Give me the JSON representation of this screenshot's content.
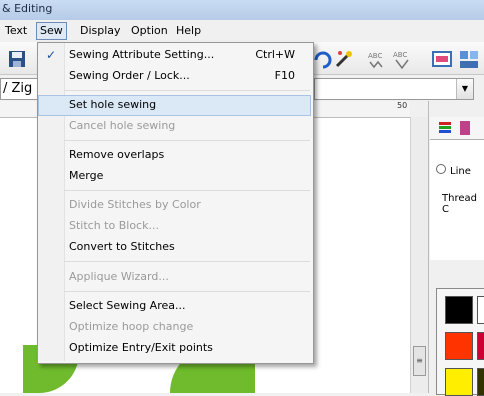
{
  "window": {
    "title": "& Editing"
  },
  "menubar": [
    {
      "label": "Text",
      "active": false
    },
    {
      "label": "Sew",
      "active": true
    },
    {
      "label": "Display",
      "active": false
    },
    {
      "label": "Option",
      "active": false
    },
    {
      "label": "Help",
      "active": false
    }
  ],
  "toolbar": {
    "font_field_value": "/ Zig",
    "combo_arrow": "▼",
    "ruler_mark": "50"
  },
  "sew_menu": {
    "items": [
      {
        "label": "Sewing Attribute Setting...",
        "shortcut": "Ctrl+W",
        "checked": true,
        "enabled": true
      },
      {
        "label": "Sewing Order / Lock...",
        "shortcut": "F10",
        "enabled": true
      },
      {
        "label": "Set hole sewing",
        "shortcut": "",
        "enabled": true,
        "highlighted": true
      },
      {
        "label": "Cancel hole sewing",
        "shortcut": "",
        "enabled": false
      },
      {
        "label": "Remove overlaps",
        "shortcut": "",
        "enabled": true
      },
      {
        "label": "Merge",
        "shortcut": "",
        "enabled": true
      },
      {
        "label": "Divide Stitches by Color",
        "shortcut": "",
        "enabled": false
      },
      {
        "label": "Stitch to Block...",
        "shortcut": "",
        "enabled": false
      },
      {
        "label": "Convert to Stitches",
        "shortcut": "",
        "enabled": true
      },
      {
        "label": "Applique Wizard...",
        "shortcut": "",
        "enabled": false
      },
      {
        "label": "Select Sewing Area...",
        "shortcut": "",
        "enabled": true
      },
      {
        "label": "Optimize hoop change",
        "shortcut": "",
        "enabled": false
      },
      {
        "label": "Optimize Entry/Exit points",
        "shortcut": "",
        "enabled": true
      }
    ]
  },
  "right_panel": {
    "radio_label": "Line",
    "thread_label": "Thread C",
    "swatch_colors": [
      "#000000",
      "#ffffff",
      "#ff3300",
      "#cc0033",
      "#ffee00",
      "#333300"
    ]
  },
  "canvas": {
    "scroll_glyph": "≡",
    "shape_color": "#6fbb2d"
  }
}
